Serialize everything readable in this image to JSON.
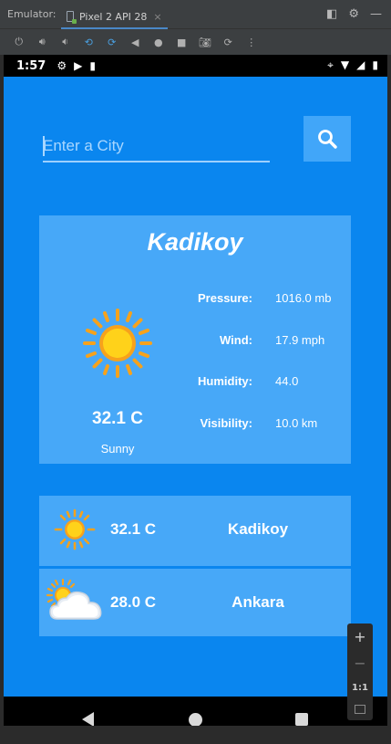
{
  "emulator": {
    "label": "Emulator:",
    "tab_title": "Pixel 2 API 28",
    "close_glyph": "×",
    "toolbar_icons": [
      "power-icon",
      "volume-up-icon",
      "volume-down-icon",
      "rotate-left-icon",
      "rotate-right-icon",
      "back-icon",
      "home-icon",
      "overview-icon",
      "camera-icon",
      "snapshot-icon",
      "more-icon"
    ]
  },
  "status_bar": {
    "time": "1:57"
  },
  "search": {
    "placeholder": "Enter a City"
  },
  "current": {
    "city": "Kadikoy",
    "temperature": "32.1 C",
    "condition": "Sunny",
    "details": [
      {
        "label": "Pressure:",
        "value": "1016.0 mb"
      },
      {
        "label": "Wind:",
        "value": "17.9 mph"
      },
      {
        "label": "Humidity:",
        "value": "44.0"
      },
      {
        "label": "Visibility:",
        "value": "10.0 km"
      }
    ]
  },
  "history": [
    {
      "temperature": "32.1 C",
      "city": "Kadikoy",
      "icon": "sun-icon"
    },
    {
      "temperature": "28.0 C",
      "city": "Ankara",
      "icon": "partly-cloudy-icon"
    }
  ],
  "zoom": {
    "plus": "+",
    "minus": "−",
    "ratio": "1:1"
  },
  "colors": {
    "screen_bg": "#0a86ef",
    "card_bg": "#47a8f8",
    "sun_yellow": "#ffd21a",
    "sun_orange": "#f6a21c"
  }
}
